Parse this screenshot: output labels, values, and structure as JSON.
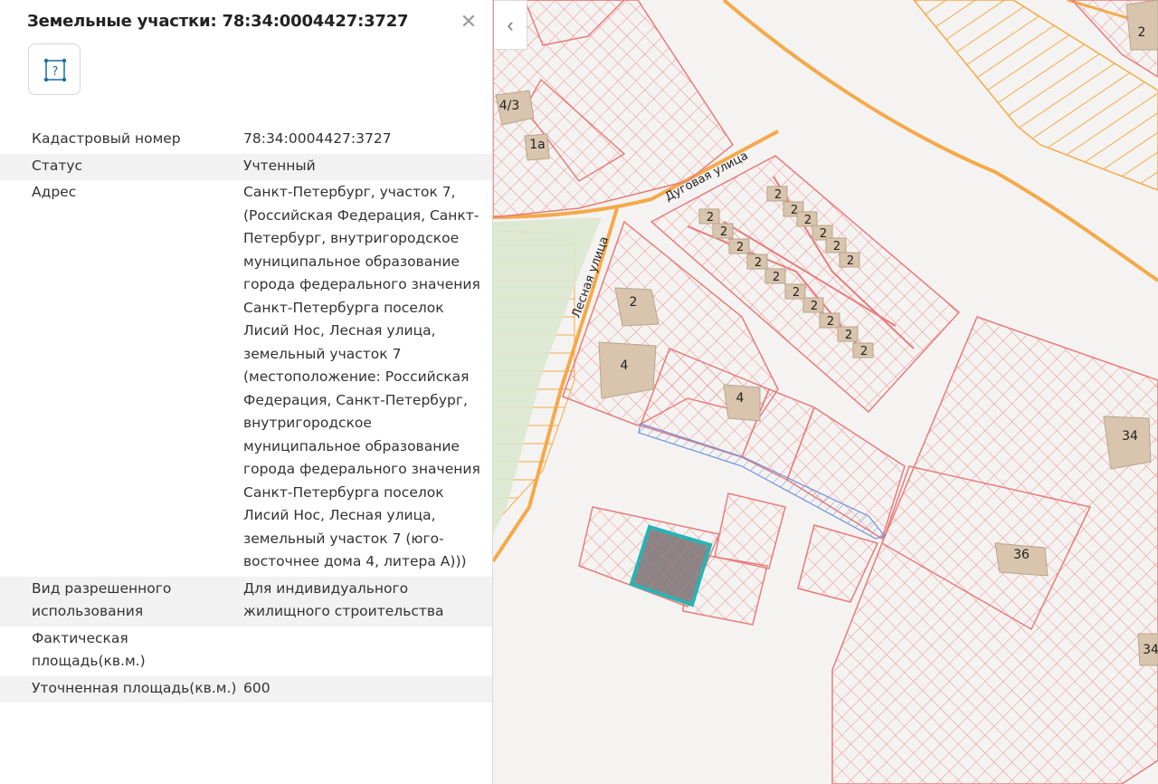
{
  "panel": {
    "title": "Земельные участки: 78:34:0004427:3727",
    "close_glyph": "✕",
    "type_icon": "parcel-help-icon",
    "type_icon_glyph": "?",
    "properties": [
      {
        "key": "Кадастровый номер",
        "value": "78:34:0004427:3727"
      },
      {
        "key": "Статус",
        "value": "Учтенный"
      },
      {
        "key": "Адрес",
        "value": "Санкт-Петербург, участок 7, (Российская Федерация, Санкт-Петербург, внутригородское муниципальное образование города федерального значения Санкт-Петербурга поселок Лисий Нос, Лесная улица, земельный участок 7 (местоположение: Российская Федерация, Санкт-Петербург, внутригородское муниципальное образование города федерального значения Санкт-Петербурга поселок Лисий Нос, Лесная улица, земельный участок 7 (юго-восточнее дома 4, литера А)))"
      },
      {
        "key": "Вид разрешенного использования",
        "value": "Для индивидуального жилищного строительства"
      },
      {
        "key": "Фактическая площадь(кв.м.)",
        "value": ""
      },
      {
        "key": "Уточненная площадь(кв.м.)",
        "value": "600"
      }
    ]
  },
  "map": {
    "collapse_glyph": "‹",
    "streets": [
      "Дуговая улица",
      "Лесная улица"
    ],
    "building_labels": [
      "4/3",
      "1а",
      "2",
      "2",
      "2",
      "2",
      "2",
      "2",
      "2",
      "2",
      "2",
      "2",
      "2",
      "2",
      "2",
      "2",
      "2",
      "2",
      "2",
      "2",
      "2",
      "2",
      "4",
      "4",
      "34",
      "36",
      "34",
      "2"
    ],
    "colors": {
      "background": "#f4f3f1",
      "parcel": "#ec8c8c",
      "road": "#f5a94a",
      "building": "#d9c5ad",
      "park": "#dbe8cf",
      "selected_fill": "#8b8385",
      "selected_outline": "#22b5b5",
      "easement": "#6f90d8"
    }
  }
}
